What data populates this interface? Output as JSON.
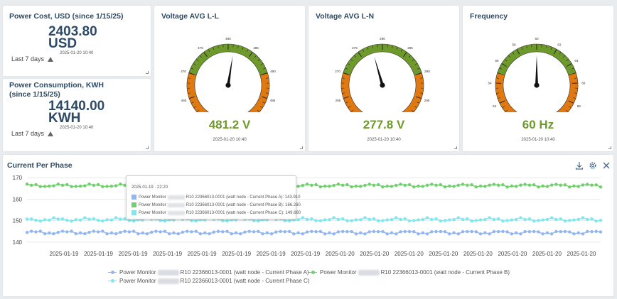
{
  "cost_card": {
    "title": "Power Cost, USD (since 1/15/25)",
    "value": "2403.80",
    "unit": "USD",
    "timestamp": "2025-01-20 10:40",
    "period": "Last 7 days"
  },
  "consumption_card": {
    "title": "Power Consumption, KWH (since 1/15/25)",
    "value": "14140.00",
    "unit": "KWH",
    "timestamp": "2025-01-20 10:40",
    "period": "Last 7 days"
  },
  "gauges": [
    {
      "title": "Voltage AVG L-L",
      "reading": "481.2 V",
      "value": 481.2,
      "min": 460,
      "max": 500,
      "green_range": [
        470,
        490
      ],
      "ticks": [
        "460",
        "465",
        "470",
        "475",
        "480",
        "485",
        "490",
        "495",
        "500"
      ],
      "timestamp": "2025-01-20 10:40"
    },
    {
      "title": "Voltage AVG L-N",
      "reading": "277.8 V",
      "value": 277.8,
      "min": 260,
      "max": 300,
      "green_range": [
        270,
        290
      ],
      "ticks": [
        "260",
        "265",
        "270",
        "275",
        "280",
        "285",
        "290",
        "295",
        "300"
      ],
      "timestamp": "2025-01-20 10:40"
    },
    {
      "title": "Frequency",
      "reading": "60 Hz",
      "value": 60,
      "min": 50,
      "max": 70,
      "green_range": [
        55,
        65
      ],
      "ticks": [
        "50",
        "52",
        "54",
        "56",
        "58",
        "60",
        "62",
        "64",
        "66",
        "68",
        "70"
      ],
      "timestamp": "2025-01-20 10:40"
    }
  ],
  "colors": {
    "green": "#6e9a2b",
    "orange": "#e07a10",
    "title": "#2d4a66"
  },
  "chart_panel": {
    "title": "Current Per Phase",
    "icons": [
      "download-icon",
      "gear-icon",
      "close-icon"
    ]
  },
  "tooltip": {
    "title": "2025-01-19 · 22:20",
    "rows": [
      {
        "prefix": "Power Monitor",
        "suffix": "R10 22366013-0001 (watt node - Current Phase A): 143.910",
        "color": "#93b6f2"
      },
      {
        "prefix": "Power Monitor",
        "suffix": "R10 22366013-0001 (watt node - Current Phase B): 166.260",
        "color": "#6fd16b"
      },
      {
        "prefix": "Power Monitor",
        "suffix": "R10 22366013-0001 (watt node - Current Phase C): 149.660",
        "color": "#7fe8ef"
      }
    ]
  },
  "chart_data": {
    "type": "line",
    "title": "",
    "xlabel": "",
    "ylabel": "",
    "ylim": [
      137,
      172
    ],
    "yticks": [
      140,
      150,
      160,
      170
    ],
    "x_tick_labels": [
      "2025-01-19",
      "2025-01-19",
      "2025-01-19",
      "2025-01-19",
      "2025-01-19",
      "2025-01-19",
      "2025-01-19",
      "2025-01-19",
      "2025-01-20",
      "2025-01-20",
      "2025-01-20",
      "2025-01-20",
      "2025-01-20",
      "2025-01-20",
      "2025-01-20",
      "2025-01-20"
    ],
    "grid": true,
    "legend_position": "bottom",
    "series": [
      {
        "name": "Power Monitor R10 22366013-0001 (watt node - Current Phase A)",
        "color": "#93b6f2",
        "legend_prefix": "Power Monitor",
        "legend_suffix": "R10 22366013-0001 (watt node - Current Phase A)",
        "base": 144.5,
        "amplitude": 0.9
      },
      {
        "name": "Power Monitor R10 22366013-0001 (watt node - Current Phase B)",
        "color": "#6fd16b",
        "legend_prefix": "Power Monitor",
        "legend_suffix": "R10 22366013-0001 (watt node - Current Phase B)",
        "base": 166.3,
        "amplitude": 0.8
      },
      {
        "name": "Power Monitor R10 22366013-0001 (watt node - Current Phase C)",
        "color": "#7fe8ef",
        "legend_prefix": "Power Monitor",
        "legend_suffix": "R10 22366013-0001 (watt node - Current Phase C)",
        "base": 150.5,
        "amplitude": 0.9
      }
    ]
  }
}
